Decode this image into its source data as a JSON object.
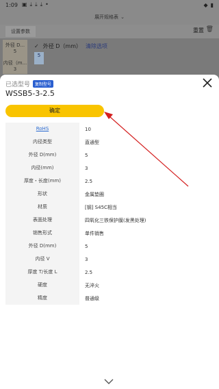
{
  "status_bar": {
    "time": "1:09",
    "icons_left": [
      "image-icon",
      "download-icon",
      "download-icon",
      "download-icon",
      "dot-icon"
    ],
    "icons_right": [
      "wifi-icon",
      "battery-icon"
    ]
  },
  "background": {
    "title": "展开规格表",
    "tab": "设置参数",
    "reset": "重置",
    "left_items": [
      "外径 D...",
      "5",
      "内径（m...",
      "3"
    ],
    "filter_label": "外径 D（mm）",
    "clear_label": "清除选项",
    "chip": "5"
  },
  "sheet": {
    "selected_label": "已选型号",
    "badge": "复制型号",
    "model": "WSSB5-3-2.5",
    "confirm": "确定",
    "rows": [
      {
        "k": "RoHS",
        "v": "10"
      },
      {
        "k": "内径类型",
        "v": "直通型"
      },
      {
        "k": "外径 D(mm)",
        "v": "5"
      },
      {
        "k": "内径(mm)",
        "v": "3"
      },
      {
        "k": "厚度・长度(mm)",
        "v": "2.5"
      },
      {
        "k": "形状",
        "v": "金属垫圈"
      },
      {
        "k": "材质",
        "v": "[钢] S45C相当"
      },
      {
        "k": "表面处理",
        "v": "四氧化三铁保护膜(发黑处理)"
      },
      {
        "k": "销售形式",
        "v": "单件销售"
      },
      {
        "k": "外径 D(mm)",
        "v": "5"
      },
      {
        "k": "内径 V",
        "v": "3"
      },
      {
        "k": "厚度 T/长度 L",
        "v": "2.5"
      },
      {
        "k": "硬度",
        "v": "无淬火"
      },
      {
        "k": "精度",
        "v": "普通级"
      }
    ]
  },
  "colors": {
    "accent": "#f9c400",
    "badge": "#2a5fd0",
    "arrow": "#d42020"
  }
}
